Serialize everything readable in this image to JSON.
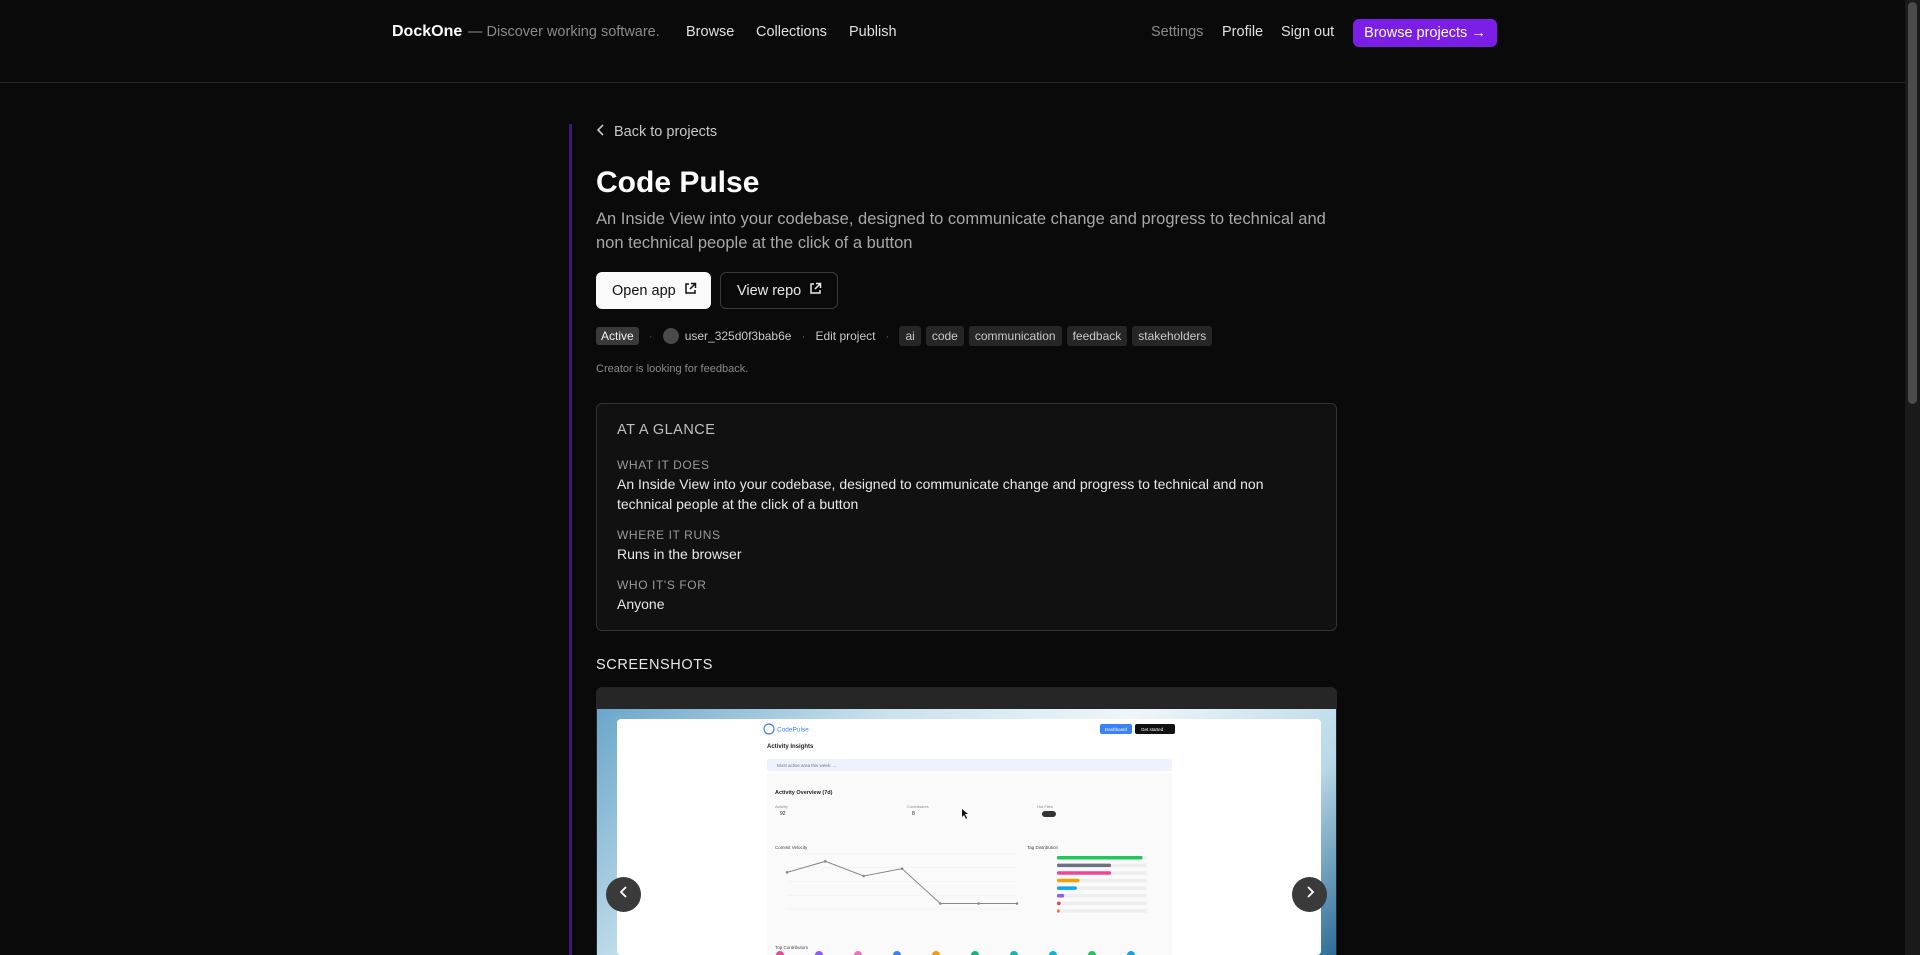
{
  "header": {
    "brand": "DockOne",
    "tagline": "— Discover working software.",
    "nav": [
      "Browse",
      "Collections",
      "Publish"
    ],
    "right_nav": [
      "Settings",
      "Profile",
      "Sign out"
    ],
    "cta": "Browse projects →"
  },
  "project": {
    "back_label": "Back to projects",
    "title": "Code Pulse",
    "description": "An Inside View into your codebase, designed to communicate change and progress to technical and non technical people at the click of a button",
    "open_app": "Open app",
    "view_repo": "View repo",
    "status": "Active",
    "owner": "user_325d0f3bab6e",
    "edit": "Edit project",
    "tags": [
      "ai",
      "code",
      "communication",
      "feedback",
      "stakeholders"
    ],
    "feedback_note": "Creator is looking for feedback."
  },
  "glance": {
    "title": "AT A GLANCE",
    "what_label": "WHAT IT DOES",
    "what_value": "An Inside View into your codebase, designed to communicate change and progress to technical and non technical people at the click of a button",
    "where_label": "WHERE IT RUNS",
    "where_value": "Runs in the browser",
    "who_label": "WHO IT'S FOR",
    "who_value": "Anyone"
  },
  "screenshots": {
    "title": "SCREENSHOTS",
    "shot": {
      "app_name": "CodePulse",
      "header_buttons": [
        "Dashboard",
        "Get started"
      ],
      "page_title": "Activity Insights",
      "banner": "Most active area this week: ...",
      "section_title": "Activity Overview (7d)",
      "stats": [
        {
          "label": "Activity",
          "value": "92"
        },
        {
          "label": "Contributors",
          "value": "8"
        },
        {
          "label": "Hot Files",
          "value": ""
        }
      ],
      "chart_title": "Commit Velocity",
      "dist_title": "Tag Distribution",
      "contributors_title": "Top Contributors",
      "chart_values": [
        20,
        26,
        18,
        22,
        3,
        3,
        3
      ],
      "dist": [
        {
          "color": "#22c55e",
          "fill": 0.95
        },
        {
          "color": "#6b7280",
          "fill": 0.6
        },
        {
          "color": "#ec4899",
          "fill": 0.6
        },
        {
          "color": "#f59e0b",
          "fill": 0.25
        },
        {
          "color": "#0ea5e9",
          "fill": 0.22
        },
        {
          "color": "#8b5cf6",
          "fill": 0.08
        },
        {
          "color": "#ef4444",
          "fill": 0.04
        },
        {
          "color": "#f97316",
          "fill": 0.03
        }
      ],
      "contributor_colors": [
        "#ec4899",
        "#8b5cf6",
        "#f472b6",
        "#3b82f6",
        "#f59e0b",
        "#10b981",
        "#14b8a6",
        "#06b6d4",
        "#22c55e",
        "#0ea5e9"
      ]
    }
  },
  "icons": {
    "back": "chevron-left-icon",
    "external": "external-link-icon",
    "prev": "chevron-left-icon",
    "next": "chevron-right-icon"
  }
}
